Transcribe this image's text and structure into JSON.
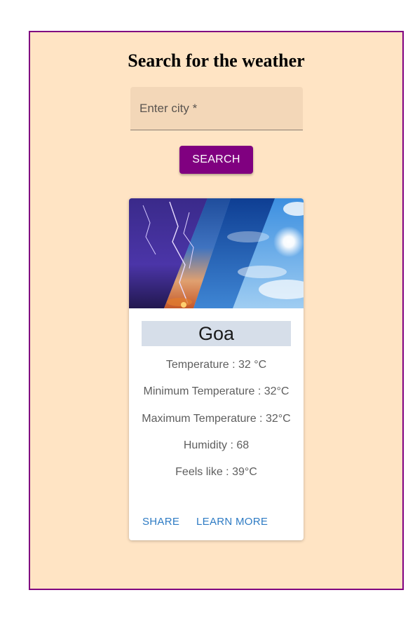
{
  "page": {
    "title": "Search for the weather",
    "accent_color": "#800080",
    "background_color": "#ffe4c4"
  },
  "search": {
    "placeholder": "Enter city *",
    "value": "",
    "button_label": "SEARCH"
  },
  "card": {
    "image": "weather-collage-image",
    "city": "Goa",
    "stats": [
      "Temperature : 32 °C",
      "Minimum Temperature : 32°C",
      "Maximum Temperature : 32°C",
      "Humidity : 68",
      "Feels like : 39°C"
    ],
    "actions": {
      "share_label": "SHARE",
      "learn_more_label": "LEARN MORE",
      "link_color": "#2e7bc4"
    }
  }
}
